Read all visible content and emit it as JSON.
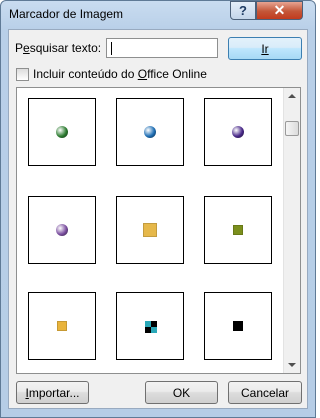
{
  "window": {
    "title": "Marcador de Imagem",
    "help_label": "?",
    "close_label": "✕"
  },
  "search": {
    "label_before": "P",
    "label_access_key": "e",
    "label_after": "squisar texto:",
    "value": ""
  },
  "go_button": {
    "label": "Ir"
  },
  "include_online": {
    "label_before": "Incluir conteúdo do ",
    "label_access_key": "O",
    "label_after": "ffice Online",
    "checked": false
  },
  "gallery": {
    "bullets": [
      {
        "name": "green-sphere-bullet",
        "shape": "sphere",
        "color": "#2e7d32"
      },
      {
        "name": "blue-sphere-bullet",
        "shape": "sphere",
        "color": "#1f6fb5"
      },
      {
        "name": "purple-sphere-bullet",
        "shape": "sphere",
        "color": "#4a2a8a"
      },
      {
        "name": "violet-sphere-bullet",
        "shape": "sphere",
        "color": "#7b4fa0"
      },
      {
        "name": "gold-texture-square-bullet",
        "shape": "square",
        "color": "#e6b84a"
      },
      {
        "name": "olive-square-bullet",
        "shape": "square",
        "color": "#7b8f1c"
      },
      {
        "name": "yellow-square-bullet",
        "shape": "square",
        "color": "#e9b43c"
      },
      {
        "name": "teal-checker-bullet",
        "shape": "checker",
        "color": "#2aa8b8"
      },
      {
        "name": "black-square-bullet",
        "shape": "square",
        "color": "#000000"
      }
    ]
  },
  "buttons": {
    "import_label": "Importar...",
    "import_access_key": "I",
    "import_rest": "mportar...",
    "ok_label": "OK",
    "cancel_label": "Cancelar"
  }
}
